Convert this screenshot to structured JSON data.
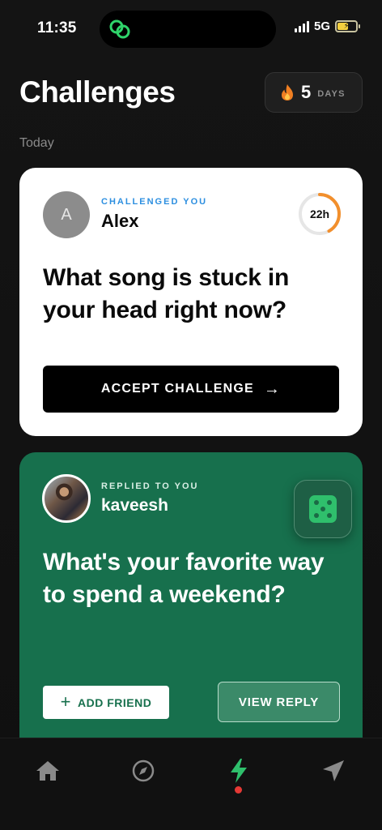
{
  "status_bar": {
    "time": "11:35",
    "network": "5G",
    "island_icon": "link-rings-icon",
    "battery_icon": "battery-charging-icon"
  },
  "header": {
    "title": "Challenges",
    "streak": {
      "icon": "flame-icon",
      "count": "5",
      "unit": "DAYS"
    }
  },
  "section_label": "Today",
  "challenge_card": {
    "avatar_letter": "A",
    "label": "CHALLENGED YOU",
    "user": "Alex",
    "timer": "22h",
    "timer_progress": 0.42,
    "question": "What song is stuck in your head right now?",
    "action_label": "ACCEPT CHALLENGE",
    "action_icon": "arrow-right-icon",
    "accent_color": "#2d8fe0"
  },
  "reply_card": {
    "label": "REPLIED TO YOU",
    "user": "kaveesh",
    "question": "What's your favorite way to spend a weekend?",
    "add_friend_label": "ADD FRIEND",
    "view_reply_label": "VIEW REPLY",
    "dice_icon": "dice-icon",
    "background_color": "#17704d"
  },
  "bottom_nav": {
    "items": [
      {
        "name": "home",
        "icon": "home-icon",
        "active": false
      },
      {
        "name": "explore",
        "icon": "compass-icon",
        "active": false
      },
      {
        "name": "challenges",
        "icon": "lightning-icon",
        "active": true
      },
      {
        "name": "send",
        "icon": "paper-plane-icon",
        "active": false
      }
    ],
    "active_color": "#2fbf6c",
    "badge_color": "#e53935"
  }
}
